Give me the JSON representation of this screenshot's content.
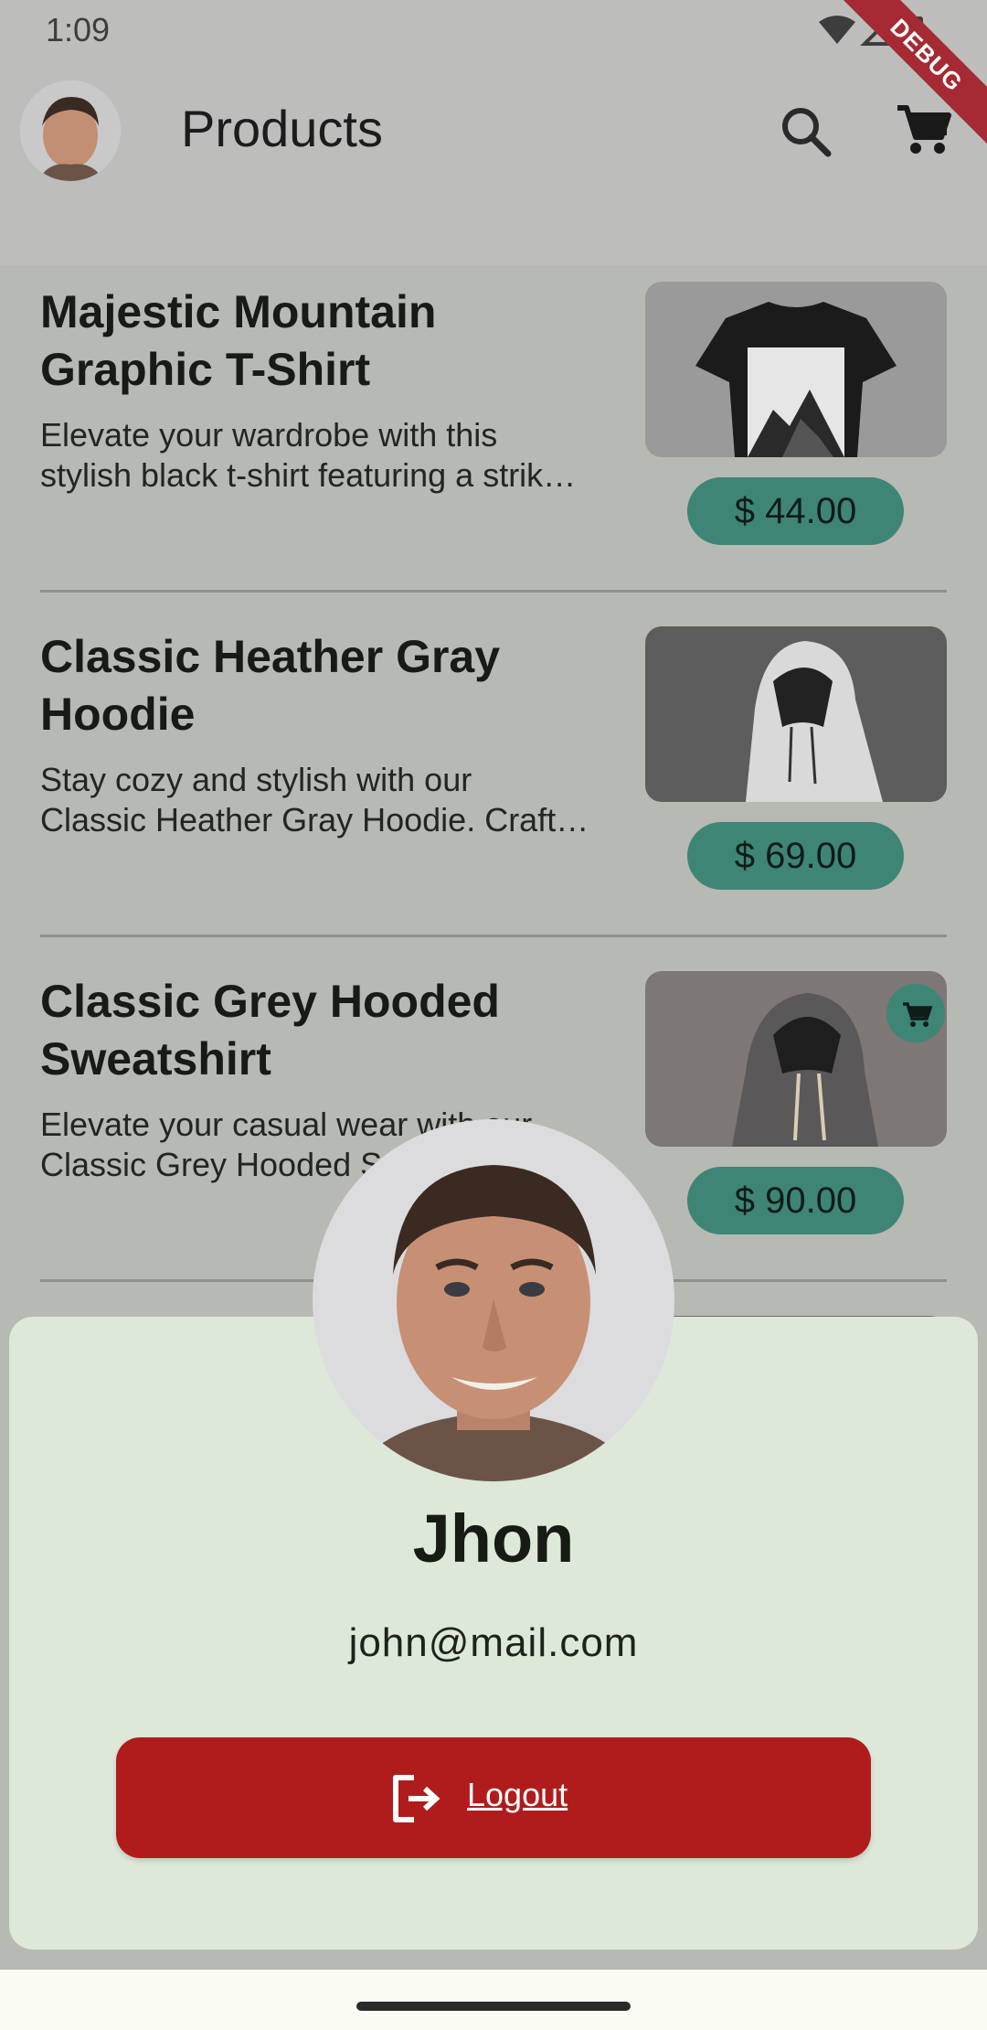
{
  "status_bar": {
    "time": "1:09",
    "debug_label": "DEBUG"
  },
  "app_bar": {
    "title": "Products",
    "search_icon": "search-icon",
    "cart_icon": "cart-icon"
  },
  "products": [
    {
      "title": "Majestic Mountain\nGraphic T-Shirt",
      "description": "Elevate your wardrobe with this\nstylish black t-shirt featuring a strik…",
      "price": "$ 44.00",
      "image": "black-tshirt-mountain-image"
    },
    {
      "title": "Classic Heather Gray\nHoodie",
      "description": "Stay cozy and stylish with our\nClassic Heather Gray Hoodie. Craft…",
      "price": "$ 69.00",
      "image": "heather-gray-hoodie-image"
    },
    {
      "title": "Classic Grey Hooded\nSweatshirt",
      "description": "Elevate your casual wear with our\nClassic Grey Hooded S",
      "price": "$ 90.00",
      "image": "grey-hooded-sweatshirt-image",
      "in_cart": true
    }
  ],
  "profile_sheet": {
    "name": "Jhon",
    "email": "john@mail.com",
    "logout_label": "Logout"
  },
  "colors": {
    "price_pill": "#3f8576",
    "logout_button": "#b01c1b",
    "sheet_background": "#dde8d9"
  }
}
